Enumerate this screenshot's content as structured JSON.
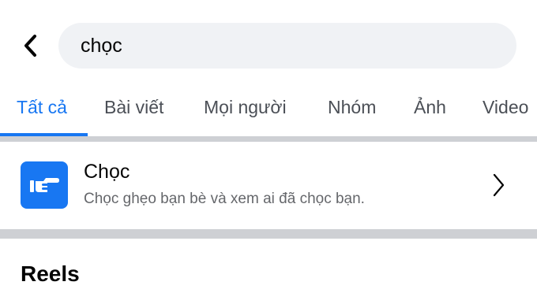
{
  "search": {
    "query": "chọc"
  },
  "tabs": [
    {
      "label": "Tất cả",
      "active": true
    },
    {
      "label": "Bài viết"
    },
    {
      "label": "Mọi người"
    },
    {
      "label": "Nhóm"
    },
    {
      "label": "Ảnh"
    },
    {
      "label": "Video"
    }
  ],
  "result": {
    "title": "Chọc",
    "subtitle": "Chọc ghẹo bạn bè và xem ai đã chọc bạn.",
    "icon": "poke-hand-icon",
    "icon_bg": "#1877f2"
  },
  "sections": {
    "reels_title": "Reels"
  },
  "colors": {
    "accent": "#1877f2",
    "search_bg": "#f0f2f5",
    "divider": "#ced0d4"
  }
}
